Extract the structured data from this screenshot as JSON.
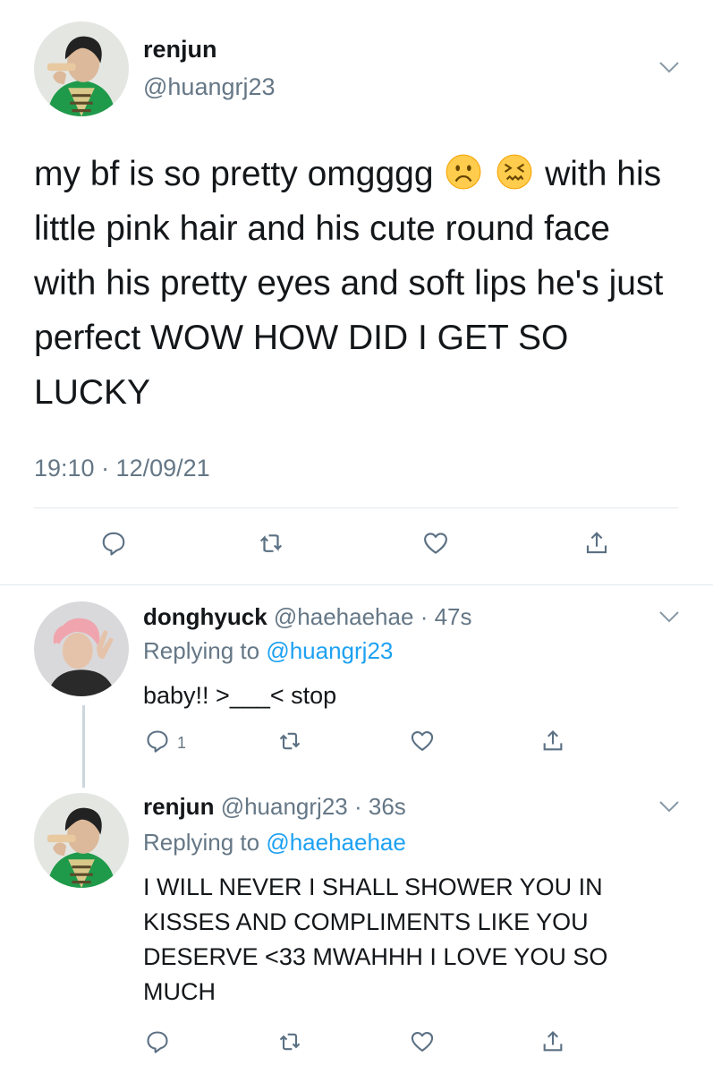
{
  "main_tweet": {
    "author_name": "renjun",
    "author_handle": "@huangrj23",
    "text_part1": "my bf is so pretty omgggg",
    "emoji_1": "frowning-face-emoji",
    "emoji_2": "confounded-face-emoji",
    "text_part2": "with his little pink hair and his cute round face with his pretty eyes and soft lips he's just perfect WOW HOW DID I GET SO LUCKY",
    "timestamp": "19:10 · 12/09/21",
    "actions": [
      "reply-icon",
      "retweet-icon",
      "like-icon",
      "share-icon"
    ]
  },
  "replies": [
    {
      "author_name": "donghyuck",
      "author_handle": "@haehaehae",
      "time": "· 47s",
      "replying_prefix": "Replying to",
      "replying_to": "@huangrj23",
      "text": "baby!! >___< stop",
      "reply_count": "1"
    },
    {
      "author_name": "renjun",
      "author_handle": "@huangrj23",
      "time": "· 36s",
      "replying_prefix": "Replying to",
      "replying_to": "@haehaehae",
      "text": "I WILL NEVER I SHALL SHOWER YOU IN KISSES AND COMPLIMENTS LIKE YOU DESERVE <33 MWAHHH I LOVE YOU SO MUCH"
    }
  ],
  "colors": {
    "text": "#14171a",
    "secondary": "#657786",
    "link": "#1da1f2",
    "divider": "#e1e8ed",
    "thread_line": "#ccd6dd",
    "icon": "#5b7083"
  }
}
